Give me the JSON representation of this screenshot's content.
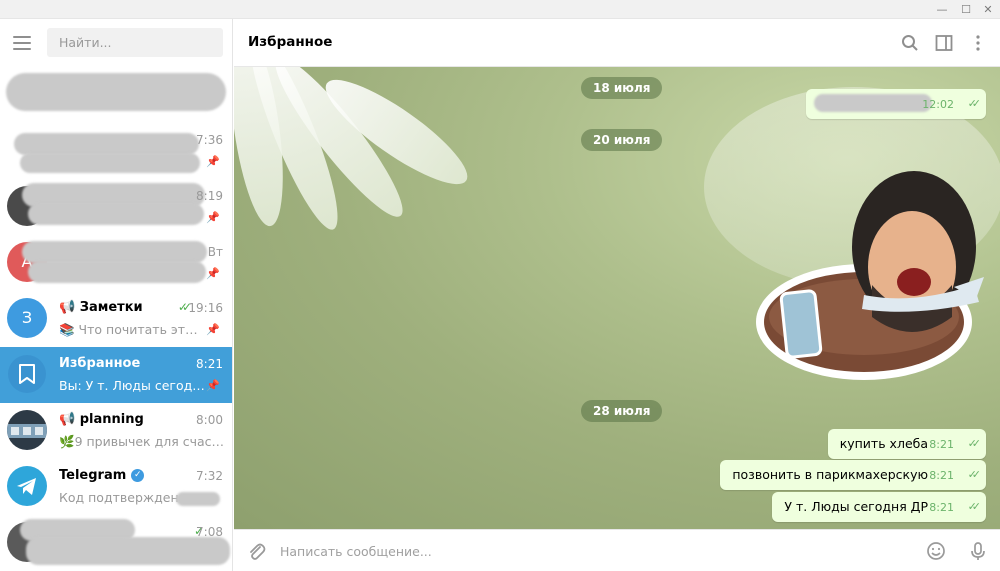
{
  "window": {
    "minimize": "—",
    "maximize": "☐",
    "close": "✕"
  },
  "search": {
    "placeholder": "Найти..."
  },
  "chats": [
    {
      "name": "",
      "time": "",
      "message": "",
      "avatar_color": "#c9c9c9",
      "blurred": true
    },
    {
      "name": "",
      "time": "7:36",
      "message": "",
      "avatar_color": "#c9c9c9",
      "blurred": true
    },
    {
      "name": "",
      "time": "8:19",
      "message": "",
      "avatar_color": "#4a4a4a",
      "blurred": true
    },
    {
      "name": "",
      "time": "Вт",
      "message": "",
      "avatar_color": "#e05a5a",
      "avatar_text": "А",
      "blurred": true
    },
    {
      "name": "Заметки",
      "time": "19:16",
      "message": "Что почитать этим л...",
      "avatar_color": "#3e9be0",
      "avatar_text": "З",
      "read": true,
      "pinned": true
    },
    {
      "name": "Избранное",
      "time": "8:21",
      "message": "Вы: У т. Люды сегодня ДР",
      "avatar_color": "#fff",
      "active": true,
      "pinned": true
    },
    {
      "name": "planning",
      "time": "8:00",
      "message": "9 привычек для счастья ...",
      "avatar_color": "#2d3a46"
    },
    {
      "name": "Telegram",
      "time": "7:32",
      "message": "Код подтверждения:",
      "avatar_color": "#2ea6da",
      "verified": true
    },
    {
      "name": "",
      "time": "7:08",
      "message": "",
      "avatar_color": "#5a5a5a",
      "blurred": true,
      "read": true
    }
  ],
  "header": {
    "title": "Избранное"
  },
  "messages": {
    "date1": "18 июля",
    "msg_hidden_time": "12:02",
    "date2": "20 июля",
    "date3": "28 июля",
    "m1_text": "купить хлеба",
    "m1_time": "8:21",
    "m2_text": "позвонить в парикмахерскую",
    "m2_time": "8:21",
    "m3_text": "У т. Люды сегодня ДР",
    "m3_time": "8:21"
  },
  "composer": {
    "placeholder": "Написать сообщение..."
  },
  "colors": {
    "accent": "#419fd9",
    "bubble": "#efffde",
    "check": "#4fae4e"
  }
}
